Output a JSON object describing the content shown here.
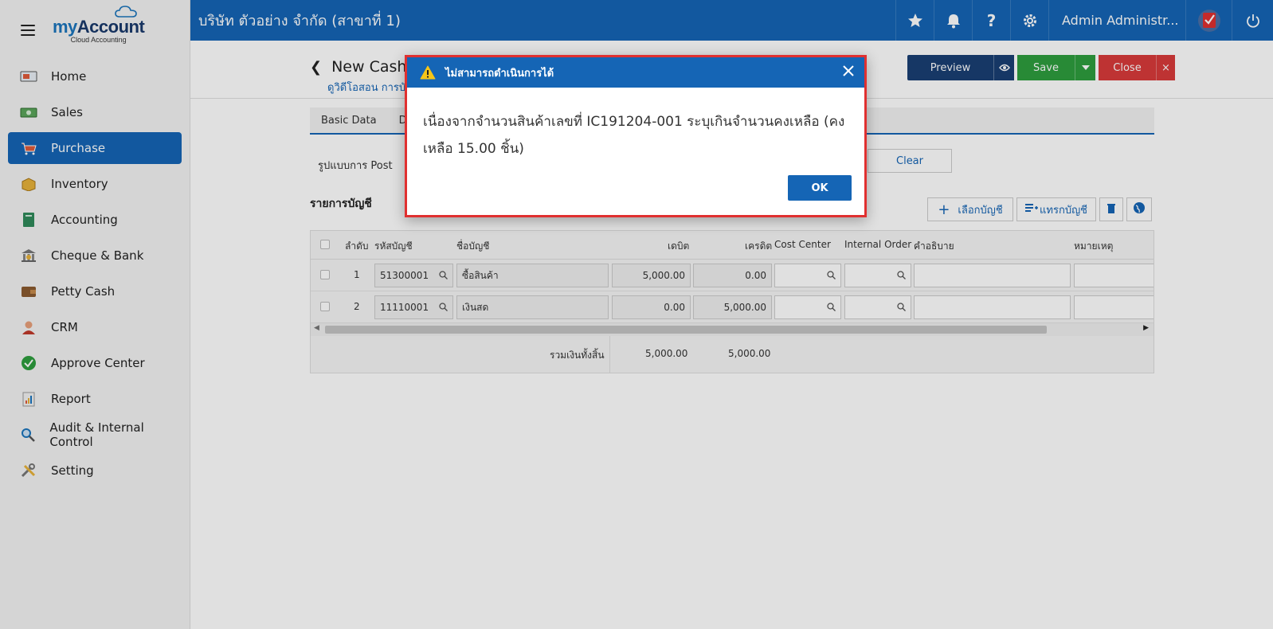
{
  "brand": {
    "name_prefix": "my",
    "name_suffix": "Account",
    "tagline": "Cloud Accounting"
  },
  "sidebar": {
    "items": [
      {
        "label": "Home",
        "icon": "home-icon"
      },
      {
        "label": "Sales",
        "icon": "sales-icon"
      },
      {
        "label": "Purchase",
        "icon": "purchase-icon",
        "active": true
      },
      {
        "label": "Inventory",
        "icon": "inventory-icon"
      },
      {
        "label": "Accounting",
        "icon": "accounting-icon"
      },
      {
        "label": "Cheque & Bank",
        "icon": "bank-icon"
      },
      {
        "label": "Petty Cash",
        "icon": "wallet-icon"
      },
      {
        "label": "CRM",
        "icon": "crm-icon"
      },
      {
        "label": "Approve Center",
        "icon": "check-circle-icon"
      },
      {
        "label": "Report",
        "icon": "report-icon"
      },
      {
        "label": "Audit & Internal Control",
        "icon": "magnifier-icon"
      },
      {
        "label": "Setting",
        "icon": "tools-icon"
      }
    ]
  },
  "topbar": {
    "company": "บริษัท ตัวอย่าง จำกัด (สาขาที่ 1)",
    "user": "Admin Administr..."
  },
  "page": {
    "title": "New Cash P",
    "subtitle": "ดูวิดีโอสอน การบั",
    "preview_label": "Preview",
    "save_label": "Save",
    "close_label": "Close",
    "tabs": [
      "Basic Data",
      "D"
    ],
    "post_label": "รูปแบบการ Post",
    "clear_label": "Clear"
  },
  "accounts": {
    "title": "รายการบัญชี",
    "select_label": "เลือกบัญชี",
    "insert_label": "แทรกบัญชี",
    "columns": {
      "seq": "ลำดับ",
      "code": "รหัสบัญชี",
      "name": "ชื่อบัญชี",
      "debit": "เดบิต",
      "credit": "เครดิต",
      "cost_center": "Cost Center",
      "internal_order": "Internal Order",
      "description": "คำอธิบาย",
      "note": "หมายเหตุ"
    },
    "rows": [
      {
        "seq": "1",
        "code": "51300001",
        "name": "ซื้อสินค้า",
        "debit": "5,000.00",
        "credit": "0.00"
      },
      {
        "seq": "2",
        "code": "11110001",
        "name": "เงินสด",
        "debit": "0.00",
        "credit": "5,000.00"
      }
    ],
    "total_label": "รวมเงินทั้งสิ้น",
    "total_debit": "5,000.00",
    "total_credit": "5,000.00"
  },
  "modal": {
    "title": "ไม่สามารถดำเนินการได้",
    "message": "เนื่องจากจำนวนสินค้าเลขที่ IC191204-001 ระบุเกินจำนวนคงเหลือ (คงเหลือ 15.00 ชิ้น)",
    "ok_label": "OK"
  }
}
